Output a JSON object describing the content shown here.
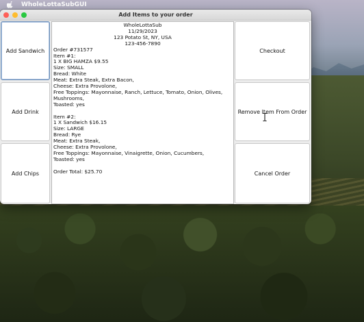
{
  "menubar": {
    "app_name": "WholeLottaSubGUI"
  },
  "window": {
    "title": "Add Items to your order"
  },
  "left_buttons": {
    "add_sandwich": "Add Sandwich",
    "add_drink": "Add Drink",
    "add_chips": "Add Chips"
  },
  "right_buttons": {
    "checkout": "Checkout",
    "remove_item": "Remove Item From Order",
    "cancel_order": "Cancel Order"
  },
  "receipt": {
    "header": [
      "WholeLottaSub",
      "11/29/2023",
      "123 Potato St, NY, USA",
      "123-456-7890"
    ],
    "order_number": "Order #731577",
    "item1": [
      "Item #1:",
      "1 X BIG HAMZA $9.55",
      "Size: SMALL",
      "Bread: White",
      "Meat: Extra Steak, Extra Bacon,",
      "Cheese: Extra Provolone,",
      "Free Toppings: Mayonnaise, Ranch, Lettuce, Tomato, Onion, Olives, Mushrooms,",
      "Toasted: yes"
    ],
    "item2": [
      "Item #2:",
      "1 X Sandwich $16.15",
      "Size: LARGE",
      "Bread: Rye",
      "Meat: Extra Steak,",
      "Cheese: Extra Provolone,",
      "Free Toppings: Mayonnaise, Vinaigrette, Onion, Cucumbers,",
      "Toasted: yes"
    ],
    "total": "Order Total: $25.70"
  },
  "icons": {
    "apple": "apple-logo-icon",
    "cursor": "text-cursor-icon"
  },
  "colors": {
    "close": "#fe5f57",
    "minimize": "#febc2e",
    "zoom": "#28c840"
  }
}
